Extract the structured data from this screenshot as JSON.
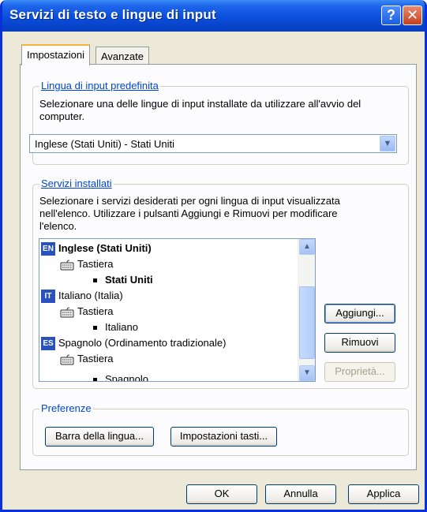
{
  "window": {
    "title": "Servizi di testo e lingue di input",
    "help_glyph": "?",
    "close_glyph": "✕"
  },
  "tabs": [
    {
      "label": "Impostazioni",
      "active": true
    },
    {
      "label": "Avanzate",
      "active": false
    }
  ],
  "default_language": {
    "legend": "Lingua di input predefinita",
    "description_line1": "Selezionare una delle lingue di input installate da utilizzare all'avvio del",
    "description_line2": "computer.",
    "selected_value": "Inglese (Stati Uniti) - Stati Uniti"
  },
  "installed_services": {
    "legend": "Servizi installati",
    "description_line1": "Selezionare i servizi desiderati per ogni lingua di input visualizzata",
    "description_line2": "nell'elenco. Utilizzare i pulsanti Aggiungi e Rimuovi per modificare",
    "description_line3": "l'elenco.",
    "items": [
      {
        "type": "language",
        "badge": "EN",
        "label": "Inglese (Stati Uniti)",
        "bold": true
      },
      {
        "type": "keyboard",
        "label": "Tastiera"
      },
      {
        "type": "layout",
        "label": "Stati Uniti",
        "bold": true
      },
      {
        "type": "language",
        "badge": "IT",
        "label": "Italiano (Italia)"
      },
      {
        "type": "keyboard",
        "label": "Tastiera"
      },
      {
        "type": "layout",
        "label": "Italiano"
      },
      {
        "type": "language",
        "badge": "ES",
        "label": "Spagnolo (Ordinamento tradizionale)"
      },
      {
        "type": "keyboard",
        "label": "Tastiera"
      },
      {
        "type": "layout",
        "label": "Spagnolo"
      }
    ],
    "buttons": {
      "add": "Aggiungi...",
      "remove": "Rimuovi",
      "properties": "Proprietà..."
    }
  },
  "preferences": {
    "legend": "Preferenze",
    "language_bar": "Barra della lingua...",
    "key_settings": "Impostazioni tasti..."
  },
  "footer": {
    "ok": "OK",
    "cancel": "Annulla",
    "apply": "Applica"
  },
  "colors": {
    "titlebar": "#0a4fdc",
    "dialog_bg": "#ece9d8",
    "legend_text": "#0046d5",
    "language_badge": "#2a52be"
  }
}
